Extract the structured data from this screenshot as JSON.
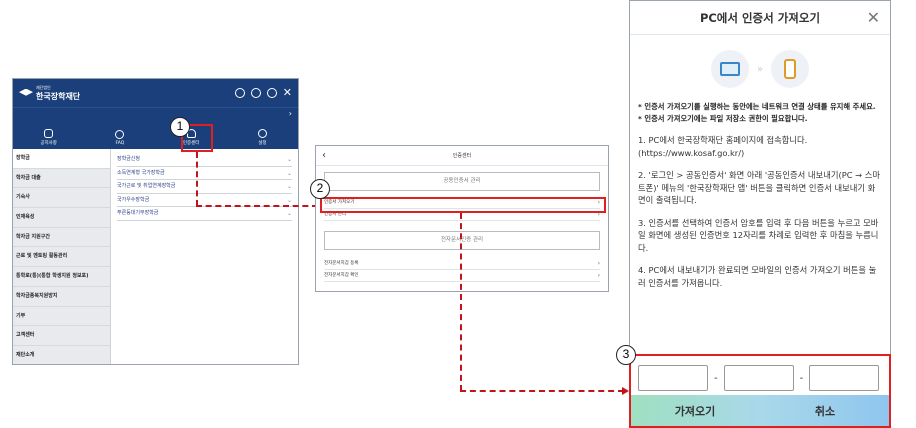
{
  "app": {
    "logo_sub": "재단법인",
    "logo_title": "한국장학재단",
    "nav": [
      {
        "label": "공지사항"
      },
      {
        "label": "FAQ"
      },
      {
        "label": "인증센터"
      },
      {
        "label": "설정"
      }
    ],
    "menu_left": [
      "장학금",
      "학자금 대출",
      "기숙사",
      "인재육성",
      "학자금 지원구간",
      "근로 및 멘토링 활동관리",
      "통학로(통)(통합 학생지원 정보포)",
      "학자금종복지원방지",
      "기부",
      "고객센터",
      "재단소개"
    ],
    "menu_right": [
      "장학금신청",
      "소득연계형 국가장학금",
      "국가근로 및 취업연계장학금",
      "국가우수장학금",
      "푸른등대기부장학금"
    ]
  },
  "cert_center": {
    "title": "인증센터",
    "public_cert_button": "공동인증서 관리",
    "rows_top": [
      "인증서 가져오기",
      "인증서 관리"
    ],
    "esign_button": "전자문서인증 관리",
    "rows_bottom": [
      "전자문서지갑 등록",
      "전자문서지갑 확인"
    ]
  },
  "dialog": {
    "title": "PC에서 인증서 가져오기",
    "warnings": [
      "* 인증서 가져오기를 실행하는 동안에는 네트워크 연결 상태를 유지해 주세요.",
      "* 인증서 가져오기에는 파일 저장소 권한이 필요합니다."
    ],
    "steps": [
      "1. PC에서 한국장학재단 홈페이지에 접속합니다. (https://www.kosaf.go.kr/)",
      "2. '로그인 > 공동인증서' 화면 아래 '공동인증서 내보내기(PC → 스마트폰)' 메뉴의 '한국장학재단 앱' 버튼을 클릭하면 인증서 내보내기 화면이 출력됩니다.",
      "3. 인증서를 선택하여 인증서 암호를 입력 후 다음 버튼을 누르고 모바일 화면에 생성된 인증번호 12자리를 차례로 입력한 후 마침을 누릅니다.",
      "4. PC에서 내보내기가 완료되면 모바일의 인증서 가져오기 버튼을 눌러 인증서를 가져옵니다."
    ],
    "separator": "-",
    "ok_label": "가져오기",
    "cancel_label": "취소"
  },
  "badges": [
    "1",
    "2",
    "3"
  ],
  "colors": {
    "header": "#1a3f7a",
    "highlight": "#e02020",
    "dashed": "#c0141a"
  }
}
